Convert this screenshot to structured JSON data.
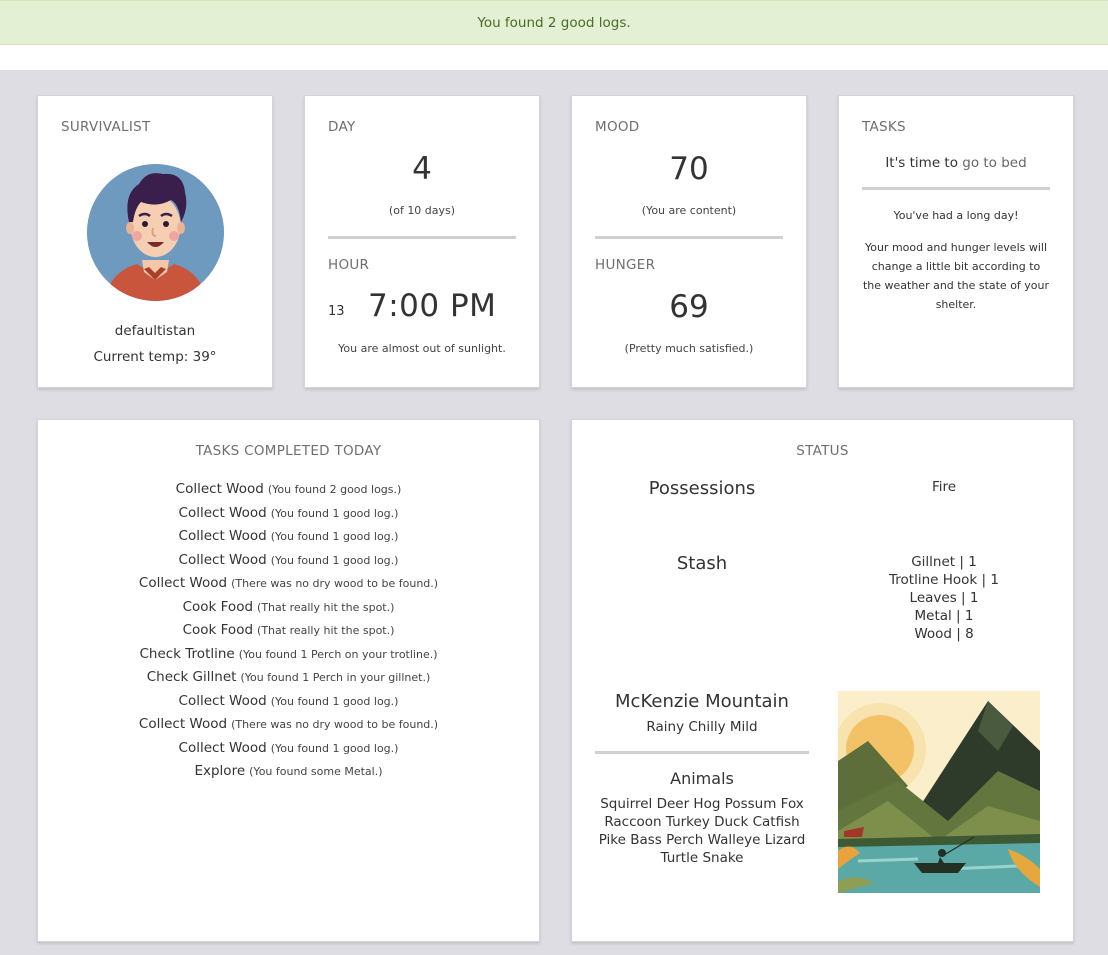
{
  "alert": {
    "message": "You found 2 good logs."
  },
  "survivalist": {
    "label": "SURVIVALIST",
    "username": "defaultistan",
    "temp": "Current temp: 39°"
  },
  "day": {
    "label": "DAY",
    "value": "4",
    "note": "(of 10 days)",
    "hour_label": "HOUR",
    "hour_number": "13",
    "time": "7:00 PM",
    "sunlight_note": "You are almost out of sunlight."
  },
  "mood": {
    "label": "MOOD",
    "value": "70",
    "note": "(You are content)",
    "hunger_label": "HUNGER",
    "hunger_value": "69",
    "hunger_note": "(Pretty much satisfied.)"
  },
  "tasks": {
    "label": "TASKS",
    "prompt_prefix": "It's time to",
    "prompt_link": "go to bed",
    "message_1": "You've had a long day!",
    "message_2": "Your mood and hunger levels will change a little bit according to the weather and the state of your shelter."
  },
  "completed": {
    "label": "TASKS COMPLETED TODAY",
    "items": [
      {
        "task": "Collect Wood",
        "note": "(You found 2 good logs.)"
      },
      {
        "task": "Collect Wood",
        "note": "(You found 1 good log.)"
      },
      {
        "task": "Collect Wood",
        "note": "(You found 1 good log.)"
      },
      {
        "task": "Collect Wood",
        "note": "(You found 1 good log.)"
      },
      {
        "task": "Collect Wood",
        "note": "(There was no dry wood to be found.)"
      },
      {
        "task": "Cook Food",
        "note": "(That really hit the spot.)"
      },
      {
        "task": "Cook Food",
        "note": "(That really hit the spot.)"
      },
      {
        "task": "Check Trotline",
        "note": "(You found 1 Perch on your trotline.)"
      },
      {
        "task": "Check Gillnet",
        "note": "(You found 1 Perch in your gillnet.)"
      },
      {
        "task": "Collect Wood",
        "note": "(You found 1 good log.)"
      },
      {
        "task": "Collect Wood",
        "note": "(There was no dry wood to be found.)"
      },
      {
        "task": "Collect Wood",
        "note": "(You found 1 good log.)"
      },
      {
        "task": "Explore",
        "note": "(You found some Metal.)"
      }
    ]
  },
  "status": {
    "label": "STATUS",
    "possessions_label": "Possessions",
    "possessions": [
      "Fire"
    ],
    "stash_label": "Stash",
    "stash": [
      "Gillnet | 1",
      "Trotline Hook | 1",
      "Leaves | 1",
      "Metal | 1",
      "Wood | 8"
    ],
    "location": "McKenzie Mountain",
    "weather": "Rainy Chilly Mild",
    "animals_label": "Animals",
    "animals_lines": [
      "Squirrel Deer Hog Possum Fox",
      "Raccoon Turkey Duck Catfish",
      "Pike Bass Perch Walleye Lizard",
      "Turtle Snake"
    ]
  },
  "colors": {
    "alert_bg": "#e3f0d4",
    "alert_text": "#4a6b25",
    "board_bg": "#dedde4",
    "link": "#666666"
  }
}
